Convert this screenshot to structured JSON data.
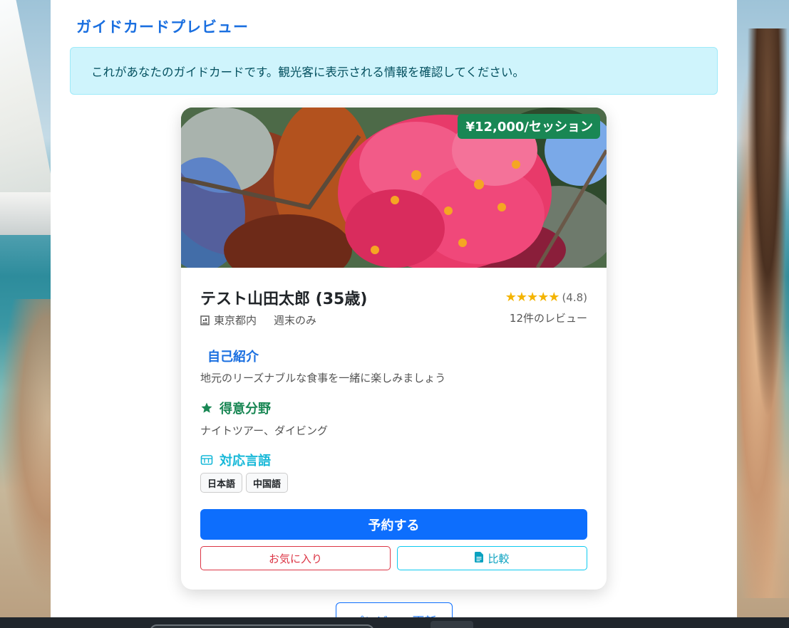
{
  "modal": {
    "title": "ガイドカードプレビュー",
    "info_message": "これがあなたのガイドカードです。観光客に表示される情報を確認してください。"
  },
  "card": {
    "price": "¥12,000/セッション",
    "name": "テスト山田太郎 (35歳)",
    "location": "東京都内",
    "availability": "週末のみ",
    "rating_stars": "★★★★★",
    "rating_value": "(4.8)",
    "review_count": "12件のレビュー",
    "sections": {
      "intro_title": "自己紹介",
      "intro_text": "地元のリーズナブルな食事を一緒に楽しみましょう",
      "skills_title": "得意分野",
      "skills_text": "ナイトツアー、ダイビング",
      "languages_title": "対応言語",
      "languages": [
        "日本語",
        "中国語"
      ]
    },
    "buttons": {
      "reserve": "予約する",
      "favorite": "お気に入り",
      "compare": "比較"
    }
  },
  "footer": {
    "refresh_button": "プレビュー更新"
  },
  "colors": {
    "primary": "#0d6efd",
    "title_blue": "#1a6fe0",
    "success": "#198754",
    "danger": "#dc3545",
    "info": "#0dcaf0",
    "info_bg": "#cff4fc",
    "star": "#f4b400"
  },
  "icons": {
    "location": "building-icon",
    "skills": "star-icon",
    "languages": "translate-icon",
    "compare": "file-icon"
  }
}
